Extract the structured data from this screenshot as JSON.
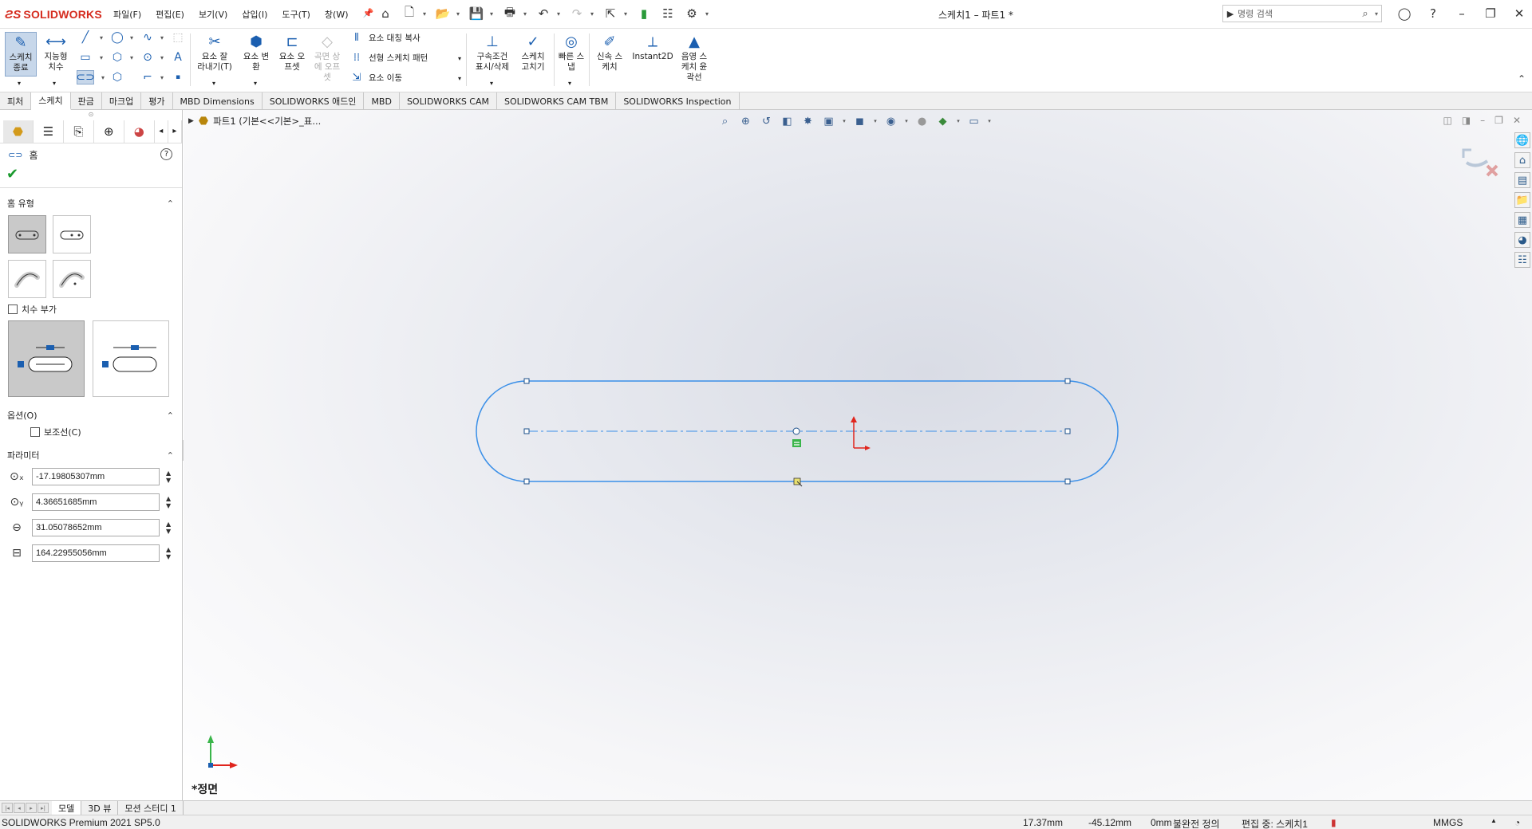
{
  "app": {
    "logo": "SOLIDWORKS",
    "doc_title": "스케치1 – 파트1 *"
  },
  "menu": [
    "파일(F)",
    "편집(E)",
    "보기(V)",
    "삽입(I)",
    "도구(T)",
    "창(W)"
  ],
  "search": {
    "placeholder": "명령 검색"
  },
  "ribbon": {
    "exit_sketch": "스케치\n종료",
    "smart_dim": "지능형\n치수",
    "trim": "요소 잘\n라내기(T)",
    "convert": "요소 변\n환",
    "offset": "요소 오\n프셋",
    "surface_offset": "곡면 상\n에 오프\n셋",
    "mirror": "요소 대칭 복사",
    "linear_pattern": "선형 스케치 패턴",
    "move": "요소 이동",
    "relations": "구속조건\n표시/삭제",
    "repair": "스케치\n고치기",
    "quick_snaps": "빠른 스\n냅",
    "rapid_sketch": "신속 스\n케치",
    "instant2d": "Instant2D",
    "shaded_contours": "음영 스\n케치 윤\n곽선"
  },
  "cm_tabs": [
    "피처",
    "스케치",
    "판금",
    "마크업",
    "평가",
    "MBD Dimensions",
    "SOLIDWORKS 애드인",
    "MBD",
    "SOLIDWORKS CAM",
    "SOLIDWORKS CAM TBM",
    "SOLIDWORKS Inspection"
  ],
  "cm_active_tab": "스케치",
  "pm": {
    "title": "홈",
    "group_slot_type": "홈 유형",
    "add_dims": "치수 부가",
    "group_options": "옵션(O)",
    "construction": "보조선(C)",
    "group_params": "파라미터",
    "params": [
      "-17.19805307mm",
      "4.36651685mm",
      "31.05078652mm",
      "164.22955056mm"
    ]
  },
  "graphics": {
    "breadcrumb": "파트1  (기본<<기본>_표...",
    "view_name": "*정면"
  },
  "bottom_tabs": [
    "모델",
    "3D 뷰",
    "모션 스터디 1"
  ],
  "status": {
    "version": "SOLIDWORKS Premium 2021 SP5.0",
    "x": "17.37mm",
    "y": "-45.12mm",
    "z": "0mm",
    "definition": "불완전 정의",
    "editing": "편집 중: 스케치1",
    "units": "MMGS"
  },
  "icons": {
    "colors": {
      "accent": "#1b5fb0",
      "sketch": "#3a8fe8",
      "logo": "#d52b1e",
      "ok": "#1a9a2e",
      "origin": "#e0251d"
    }
  }
}
